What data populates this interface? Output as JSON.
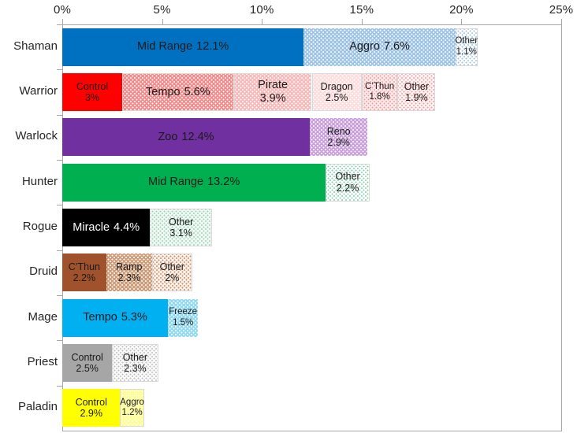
{
  "chart_data": {
    "type": "bar",
    "orientation": "horizontal",
    "stacked": true,
    "title": "",
    "xlabel": "",
    "ylabel": "",
    "xlim": [
      0,
      25
    ],
    "xunit": "%",
    "grid": false,
    "legend": "none",
    "x_tick_labels": [
      "0%",
      "5%",
      "10%",
      "15%",
      "20%",
      "25%"
    ],
    "x_tick_values": [
      0,
      5,
      10,
      15,
      20,
      25
    ],
    "categories": [
      "Shaman",
      "Warrior",
      "Warlock",
      "Hunter",
      "Rogue",
      "Druid",
      "Mage",
      "Priest",
      "Paladin"
    ],
    "rows": [
      {
        "category": "Shaman",
        "total": 20.8,
        "segments": [
          {
            "name": "Mid Range",
            "value": 12.1,
            "value_label": "12.1%",
            "color": "#0070C0",
            "pattern": "solid",
            "text_color": "#1a1a1a"
          },
          {
            "name": "Aggro",
            "value": 7.6,
            "value_label": "7.6%",
            "color": "#9DC3E6",
            "pattern": "dotted",
            "text_color": "#1a1a1a"
          },
          {
            "name": "Other",
            "value": 1.1,
            "value_label": "1.1%",
            "color": "#FFFFFF",
            "pattern": "dotted-fine",
            "dot_color": "#9DC3E6",
            "text_color": "#1a1a1a"
          }
        ]
      },
      {
        "category": "Warrior",
        "total": 17.7,
        "segments": [
          {
            "name": "Control",
            "value": 3.0,
            "value_label": "3%",
            "color": "#FF0000",
            "pattern": "solid",
            "text_color": "#1a1a1a"
          },
          {
            "name": "Tempo",
            "value": 5.6,
            "value_label": "5.6%",
            "color": "#F48A8A",
            "pattern": "dotted",
            "text_color": "#1a1a1a"
          },
          {
            "name": "Pirate",
            "value": 3.9,
            "value_label": "3.9%",
            "color": "#F9B9B9",
            "pattern": "dotted",
            "text_color": "#1a1a1a"
          },
          {
            "name": "Dragon",
            "value": 2.5,
            "value_label": "2.5%",
            "color": "#FCDCDC",
            "pattern": "dotted",
            "text_color": "#1a1a1a"
          },
          {
            "name": "C’Thun",
            "value": 1.8,
            "value_label": "1.8%",
            "color": "#FDEAEA",
            "pattern": "dotted-fine",
            "dot_color": "#F5A0A0",
            "text_color": "#1a1a1a"
          },
          {
            "name": "Other",
            "value": 1.9,
            "value_label": "1.9%",
            "color": "#FFF4F4",
            "pattern": "dotted-fine",
            "dot_color": "#F5A0A0",
            "text_color": "#1a1a1a"
          }
        ]
      },
      {
        "category": "Warlock",
        "total": 15.3,
        "segments": [
          {
            "name": "Zoo",
            "value": 12.4,
            "value_label": "12.4%",
            "color": "#7030A0",
            "pattern": "solid",
            "text_color": "#1a1a1a"
          },
          {
            "name": "Reno",
            "value": 2.9,
            "value_label": "2.9%",
            "color": "#C9A0DC",
            "pattern": "dotted",
            "text_color": "#1a1a1a"
          }
        ]
      },
      {
        "category": "Hunter",
        "total": 15.4,
        "segments": [
          {
            "name": "Mid Range",
            "value": 13.2,
            "value_label": "13.2%",
            "color": "#00B050",
            "pattern": "solid",
            "text_color": "#1a1a1a"
          },
          {
            "name": "Other",
            "value": 2.2,
            "value_label": "2.2%",
            "color": "#FFFFFF",
            "pattern": "dotted-fine",
            "dot_color": "#7FD4A8",
            "text_color": "#1a1a1a"
          }
        ]
      },
      {
        "category": "Rogue",
        "total": 7.5,
        "segments": [
          {
            "name": "Miracle",
            "value": 4.4,
            "value_label": "4.4%",
            "color": "#000000",
            "pattern": "solid",
            "text_color": "#FFFFFF"
          },
          {
            "name": "Other",
            "value": 3.1,
            "value_label": "3.1%",
            "color": "#F2F9F5",
            "pattern": "dotted-fine",
            "dot_color": "#9ED3B8",
            "text_color": "#1a1a1a"
          }
        ]
      },
      {
        "category": "Druid",
        "total": 6.5,
        "segments": [
          {
            "name": "C’Thun",
            "value": 2.2,
            "value_label": "2.2%",
            "color": "#A0522D",
            "pattern": "solid",
            "text_color": "#1a1a1a"
          },
          {
            "name": "Ramp",
            "value": 2.3,
            "value_label": "2.3%",
            "color": "#CE9B78",
            "pattern": "dotted",
            "text_color": "#1a1a1a"
          },
          {
            "name": "Other",
            "value": 2.0,
            "value_label": "2%",
            "color": "#FBF1EA",
            "pattern": "dotted-fine",
            "dot_color": "#C98F68",
            "text_color": "#1a1a1a"
          }
        ]
      },
      {
        "category": "Mage",
        "total": 6.8,
        "segments": [
          {
            "name": "Tempo",
            "value": 5.3,
            "value_label": "5.3%",
            "color": "#00B0F0",
            "pattern": "solid",
            "text_color": "#1a1a1a"
          },
          {
            "name": "Freeze",
            "value": 1.5,
            "value_label": "1.5%",
            "color": "#8FD9F5",
            "pattern": "dotted",
            "text_color": "#1a1a1a"
          }
        ]
      },
      {
        "category": "Priest",
        "total": 4.8,
        "segments": [
          {
            "name": "Control",
            "value": 2.5,
            "value_label": "2.5%",
            "color": "#A6A6A6",
            "pattern": "solid",
            "text_color": "#1a1a1a"
          },
          {
            "name": "Other",
            "value": 2.3,
            "value_label": "2.3%",
            "color": "#FAFAFA",
            "pattern": "dotted-fine",
            "dot_color": "#BFBFBF",
            "text_color": "#1a1a1a"
          }
        ]
      },
      {
        "category": "Paladin",
        "total": 4.1,
        "segments": [
          {
            "name": "Control",
            "value": 2.9,
            "value_label": "2.9%",
            "color": "#FFFF00",
            "pattern": "solid",
            "text_color": "#1a1a1a"
          },
          {
            "name": "Aggro",
            "value": 1.2,
            "value_label": "1.2%",
            "color": "#FFFF8F",
            "pattern": "dotted",
            "text_color": "#1a1a1a"
          }
        ]
      }
    ]
  },
  "colors": {
    "axis": "#a6a6a6",
    "text": "#262626",
    "background": "#ffffff"
  }
}
